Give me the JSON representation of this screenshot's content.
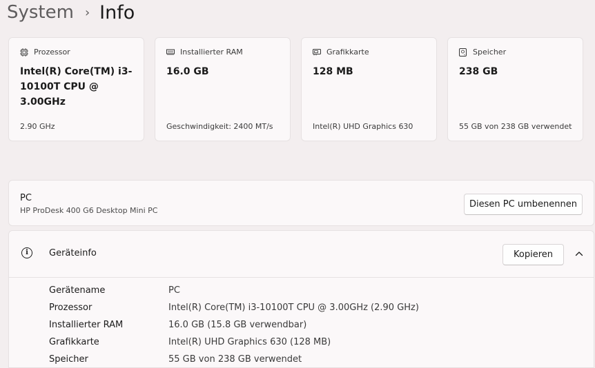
{
  "breadcrumb": {
    "parent": "System",
    "separator": "›",
    "current": "Info"
  },
  "cards": [
    {
      "icon": "processor-icon",
      "label": "Prozessor",
      "value": "Intel(R) Core(TM) i3-10100T CPU @ 3.00GHz",
      "sub": "2.90 GHz"
    },
    {
      "icon": "ram-icon",
      "label": "Installierter RAM",
      "value": "16.0 GB",
      "sub": "Geschwindigkeit: 2400 MT/s"
    },
    {
      "icon": "graphics-card-icon",
      "label": "Grafikkarte",
      "value": "128 MB",
      "sub": "Intel(R) UHD Graphics 630"
    },
    {
      "icon": "storage-icon",
      "label": "Speicher",
      "value": "238 GB",
      "sub": "55 GB von 238 GB verwendet"
    }
  ],
  "pc": {
    "title": "PC",
    "model": "HP ProDesk 400 G6 Desktop Mini PC",
    "rename_label": "Diesen PC umbenennen"
  },
  "device_info": {
    "icon": "info-icon",
    "info_glyph": "i",
    "title": "Geräteinfo",
    "copy_label": "Kopieren",
    "rows": [
      {
        "label": "Gerätename",
        "value": "PC"
      },
      {
        "label": "Prozessor",
        "value": "Intel(R) Core(TM) i3-10100T CPU @ 3.00GHz (2.90 GHz)"
      },
      {
        "label": "Installierter RAM",
        "value": "16.0 GB (15.8 GB verwendbar)"
      },
      {
        "label": "Grafikkarte",
        "value": "Intel(R) UHD Graphics 630 (128 MB)"
      },
      {
        "label": "Speicher",
        "value": "55 GB von 238 GB verwendet"
      }
    ]
  },
  "colors": {
    "background": "#f3eeef",
    "card": "#fbf8f9",
    "border": "#e6e1e2",
    "text": "#1b1b1b"
  }
}
